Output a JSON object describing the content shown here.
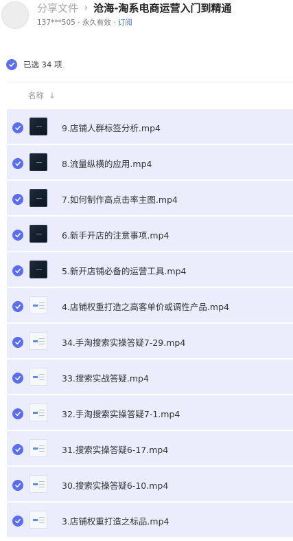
{
  "header": {
    "breadcrumb_root": "分享文件",
    "breadcrumb_sep": "›",
    "title": "沧海-淘系电商运营入门到精通",
    "owner": "137***505",
    "dot": " · ",
    "validity": "永久有效",
    "subscribe": "订阅"
  },
  "selection": {
    "text": "已选 34 项"
  },
  "column": {
    "name_label": "名称",
    "sort_icon": "arrow-down-icon",
    "sort_glyph": "↓"
  },
  "accent_color": "#5b6ef0",
  "files": [
    {
      "name": "9.店铺人群标签分析.mp4",
      "thumb": "dark"
    },
    {
      "name": "8.流量纵横的应用.mp4",
      "thumb": "dark"
    },
    {
      "name": "7.如何制作高点击率主图.mp4",
      "thumb": "dark"
    },
    {
      "name": "6.新手开店的注意事项.mp4",
      "thumb": "dark"
    },
    {
      "name": "5.新开店铺必备的运营工具.mp4",
      "thumb": "dark"
    },
    {
      "name": "4.店铺权重打造之高客单价或调性产品.mp4",
      "thumb": "light"
    },
    {
      "name": "34.手淘搜索实操答疑7-29.mp4",
      "thumb": "light"
    },
    {
      "name": "33.搜索实战答疑.mp4",
      "thumb": "light"
    },
    {
      "name": "32.手淘搜索实操答疑7-1.mp4",
      "thumb": "light"
    },
    {
      "name": "31.搜索实操答疑6-17.mp4",
      "thumb": "light"
    },
    {
      "name": "30.搜索实操答疑6-10.mp4",
      "thumb": "light"
    },
    {
      "name": "3.店铺权重打造之标品.mp4",
      "thumb": "light"
    }
  ]
}
